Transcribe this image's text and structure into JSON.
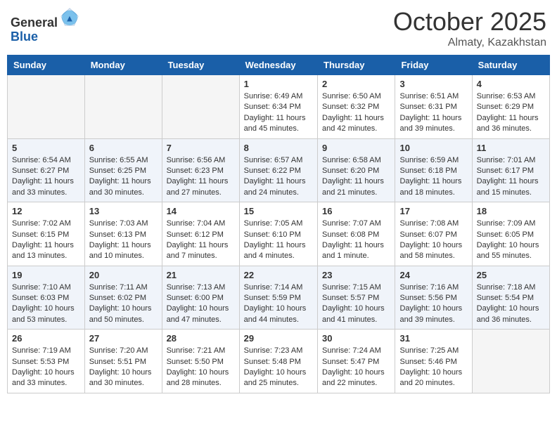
{
  "header": {
    "logo_general": "General",
    "logo_blue": "Blue",
    "month": "October 2025",
    "location": "Almaty, Kazakhstan"
  },
  "days_of_week": [
    "Sunday",
    "Monday",
    "Tuesday",
    "Wednesday",
    "Thursday",
    "Friday",
    "Saturday"
  ],
  "weeks": [
    [
      {
        "day": "",
        "info": ""
      },
      {
        "day": "",
        "info": ""
      },
      {
        "day": "",
        "info": ""
      },
      {
        "day": "1",
        "info": "Sunrise: 6:49 AM\nSunset: 6:34 PM\nDaylight: 11 hours\nand 45 minutes."
      },
      {
        "day": "2",
        "info": "Sunrise: 6:50 AM\nSunset: 6:32 PM\nDaylight: 11 hours\nand 42 minutes."
      },
      {
        "day": "3",
        "info": "Sunrise: 6:51 AM\nSunset: 6:31 PM\nDaylight: 11 hours\nand 39 minutes."
      },
      {
        "day": "4",
        "info": "Sunrise: 6:53 AM\nSunset: 6:29 PM\nDaylight: 11 hours\nand 36 minutes."
      }
    ],
    [
      {
        "day": "5",
        "info": "Sunrise: 6:54 AM\nSunset: 6:27 PM\nDaylight: 11 hours\nand 33 minutes."
      },
      {
        "day": "6",
        "info": "Sunrise: 6:55 AM\nSunset: 6:25 PM\nDaylight: 11 hours\nand 30 minutes."
      },
      {
        "day": "7",
        "info": "Sunrise: 6:56 AM\nSunset: 6:23 PM\nDaylight: 11 hours\nand 27 minutes."
      },
      {
        "day": "8",
        "info": "Sunrise: 6:57 AM\nSunset: 6:22 PM\nDaylight: 11 hours\nand 24 minutes."
      },
      {
        "day": "9",
        "info": "Sunrise: 6:58 AM\nSunset: 6:20 PM\nDaylight: 11 hours\nand 21 minutes."
      },
      {
        "day": "10",
        "info": "Sunrise: 6:59 AM\nSunset: 6:18 PM\nDaylight: 11 hours\nand 18 minutes."
      },
      {
        "day": "11",
        "info": "Sunrise: 7:01 AM\nSunset: 6:17 PM\nDaylight: 11 hours\nand 15 minutes."
      }
    ],
    [
      {
        "day": "12",
        "info": "Sunrise: 7:02 AM\nSunset: 6:15 PM\nDaylight: 11 hours\nand 13 minutes."
      },
      {
        "day": "13",
        "info": "Sunrise: 7:03 AM\nSunset: 6:13 PM\nDaylight: 11 hours\nand 10 minutes."
      },
      {
        "day": "14",
        "info": "Sunrise: 7:04 AM\nSunset: 6:12 PM\nDaylight: 11 hours\nand 7 minutes."
      },
      {
        "day": "15",
        "info": "Sunrise: 7:05 AM\nSunset: 6:10 PM\nDaylight: 11 hours\nand 4 minutes."
      },
      {
        "day": "16",
        "info": "Sunrise: 7:07 AM\nSunset: 6:08 PM\nDaylight: 11 hours\nand 1 minute."
      },
      {
        "day": "17",
        "info": "Sunrise: 7:08 AM\nSunset: 6:07 PM\nDaylight: 10 hours\nand 58 minutes."
      },
      {
        "day": "18",
        "info": "Sunrise: 7:09 AM\nSunset: 6:05 PM\nDaylight: 10 hours\nand 55 minutes."
      }
    ],
    [
      {
        "day": "19",
        "info": "Sunrise: 7:10 AM\nSunset: 6:03 PM\nDaylight: 10 hours\nand 53 minutes."
      },
      {
        "day": "20",
        "info": "Sunrise: 7:11 AM\nSunset: 6:02 PM\nDaylight: 10 hours\nand 50 minutes."
      },
      {
        "day": "21",
        "info": "Sunrise: 7:13 AM\nSunset: 6:00 PM\nDaylight: 10 hours\nand 47 minutes."
      },
      {
        "day": "22",
        "info": "Sunrise: 7:14 AM\nSunset: 5:59 PM\nDaylight: 10 hours\nand 44 minutes."
      },
      {
        "day": "23",
        "info": "Sunrise: 7:15 AM\nSunset: 5:57 PM\nDaylight: 10 hours\nand 41 minutes."
      },
      {
        "day": "24",
        "info": "Sunrise: 7:16 AM\nSunset: 5:56 PM\nDaylight: 10 hours\nand 39 minutes."
      },
      {
        "day": "25",
        "info": "Sunrise: 7:18 AM\nSunset: 5:54 PM\nDaylight: 10 hours\nand 36 minutes."
      }
    ],
    [
      {
        "day": "26",
        "info": "Sunrise: 7:19 AM\nSunset: 5:53 PM\nDaylight: 10 hours\nand 33 minutes."
      },
      {
        "day": "27",
        "info": "Sunrise: 7:20 AM\nSunset: 5:51 PM\nDaylight: 10 hours\nand 30 minutes."
      },
      {
        "day": "28",
        "info": "Sunrise: 7:21 AM\nSunset: 5:50 PM\nDaylight: 10 hours\nand 28 minutes."
      },
      {
        "day": "29",
        "info": "Sunrise: 7:23 AM\nSunset: 5:48 PM\nDaylight: 10 hours\nand 25 minutes."
      },
      {
        "day": "30",
        "info": "Sunrise: 7:24 AM\nSunset: 5:47 PM\nDaylight: 10 hours\nand 22 minutes."
      },
      {
        "day": "31",
        "info": "Sunrise: 7:25 AM\nSunset: 5:46 PM\nDaylight: 10 hours\nand 20 minutes."
      },
      {
        "day": "",
        "info": ""
      }
    ]
  ]
}
